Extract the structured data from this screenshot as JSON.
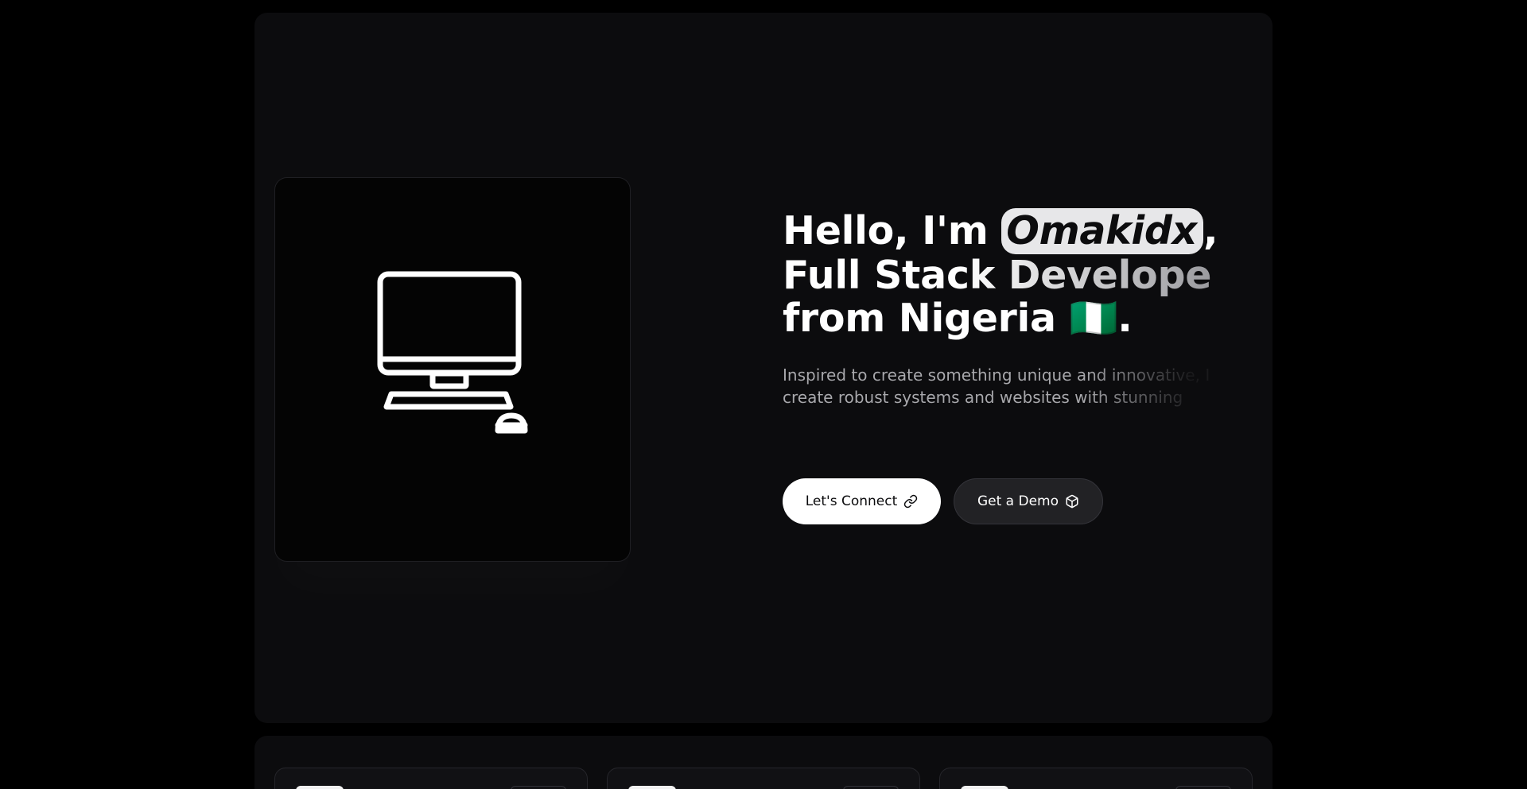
{
  "hero": {
    "greeting": "Hello, I'm ",
    "name": "Omakidx",
    "name_suffix": ",",
    "role": "Full Stack Developer",
    "origin_prefix": "from Nigeria ",
    "flag": "🇳🇬",
    "origin_suffix": ".",
    "description": "Inspired to create something unique and innovative, I create robust systems and websites with stunning",
    "illustration_icon": "desktop-computer-icon"
  },
  "actions": {
    "connect_label": "Let's Connect",
    "connect_icon": "link-icon",
    "demo_label": "Get a Demo",
    "demo_icon": "cube-icon"
  },
  "colors": {
    "background": "#000000",
    "card": "#0c0c0e",
    "primary_button": "#ffffff",
    "secondary_button": "#222225",
    "muted_text": "#a9a9ad"
  }
}
